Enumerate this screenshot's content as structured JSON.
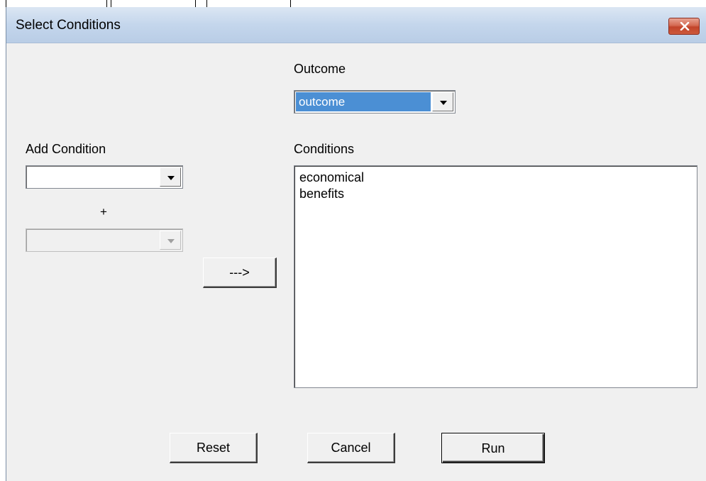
{
  "window": {
    "title": "Select Conditions"
  },
  "outcome": {
    "label": "Outcome",
    "selected": "outcome"
  },
  "add_condition": {
    "label": "Add Condition",
    "primary_value": "",
    "plus": "+",
    "secondary_value": ""
  },
  "arrow_button": {
    "label": "--->"
  },
  "conditions": {
    "label": "Conditions",
    "items": [
      "economical",
      "benefits"
    ]
  },
  "buttons": {
    "reset": "Reset",
    "cancel": "Cancel",
    "run": "Run"
  },
  "icons": {
    "close": "close-icon",
    "dropdown": "chevron-down-icon"
  },
  "colors": {
    "selection": "#4b8fd4",
    "close_button": "#c2442a",
    "titlebar": "#c4d6ec"
  }
}
